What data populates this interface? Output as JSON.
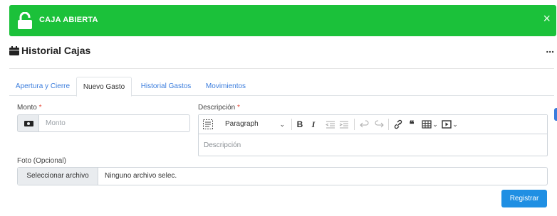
{
  "alert": {
    "title": "CAJA ABIERTA",
    "close": "×",
    "color": "#1bc13a"
  },
  "page": {
    "title": "Historial Cajas",
    "more": "..."
  },
  "tabs": [
    {
      "label": "Apertura y Cierre",
      "active": false
    },
    {
      "label": "Nuevo Gasto",
      "active": true
    },
    {
      "label": "Historial Gastos",
      "active": false
    },
    {
      "label": "Movimientos",
      "active": false
    }
  ],
  "form": {
    "monto": {
      "label": "Monto",
      "required_mark": "*",
      "placeholder": "Monto",
      "icon": "money-bill-icon"
    },
    "descripcion": {
      "label": "Descripción",
      "required_mark": "*",
      "paragraph_select": "Paragraph",
      "placeholder": "Descripción"
    },
    "foto": {
      "label": "Foto (Opcional)",
      "button": "Seleccionar archivo",
      "file_name": "Ninguno archivo selec."
    },
    "submit": "Registrar"
  },
  "toolbar": {
    "bold": "B",
    "italic": "I",
    "quote": "❝",
    "chevron": "⌄"
  },
  "colors": {
    "accent": "#3b7ddd",
    "button": "#1f8fe3",
    "success": "#1bc13a"
  }
}
